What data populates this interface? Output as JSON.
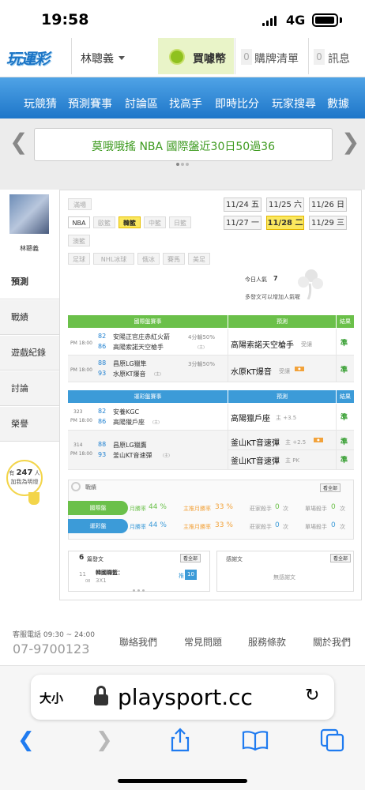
{
  "status": {
    "time": "19:58",
    "network": "4G"
  },
  "topbar": {
    "logo": "玩運彩",
    "user": "林聰義",
    "coins_label": "買噱幣",
    "cart_count": "0",
    "cart_label": "購牌清單",
    "msg_count": "0",
    "msg_label": "訊息"
  },
  "nav": [
    "玩競猜",
    "預測賽事",
    "討論區",
    "找高手",
    "即時比分",
    "玩家搜尋",
    "數據"
  ],
  "banner": {
    "text": "莫哦哦搖 NBA 國際盤近30日50過36"
  },
  "profile": {
    "name": "林聰義"
  },
  "sidebar": [
    "預測",
    "戰績",
    "遊戲紀錄",
    "討論",
    "榮譽"
  ],
  "likes": {
    "prefix": "有",
    "count": "247",
    "unit": "人",
    "sub": "加我為明燈"
  },
  "filters": {
    "row1": [
      "滿場"
    ],
    "row2": [
      "NBA",
      "歐籃",
      "韓籃",
      "中籃",
      "日籃"
    ],
    "row3": [
      "澳籃"
    ],
    "row4": [
      "足球",
      "NHL冰球",
      "俄冰",
      "賽馬",
      "美足"
    ]
  },
  "dates": {
    "row1": [
      "11/24 五",
      "11/25 六",
      "11/26 日"
    ],
    "row2": [
      "11/27 一",
      "11/28 二",
      "11/29 三"
    ]
  },
  "popularity": {
    "label": "今日人氣",
    "value": "7",
    "hint": "多發文可以增加人氣喔"
  },
  "intl_table": {
    "headers": [
      "國際盤賽事",
      "預測",
      "結果"
    ],
    "rows": [
      {
        "time": "PM 18:00",
        "num1": "82",
        "team1": "安陽正官庄赤紅火箭",
        "score": "4分輸50%",
        "num2": "86",
        "team2": "高陽索諾天空槍手",
        "mark": "(主)",
        "pick": "高陽索諾天空槍手",
        "pick_sub": "受讓",
        "result": "準"
      },
      {
        "time": "PM 18:00",
        "num1": "88",
        "team1": "昌原LG獵隼",
        "score": "3分輸50%",
        "num2": "93",
        "team2": "水原KT爆音",
        "mark": "(主)",
        "pick": "水原KT爆音",
        "pick_sub": "受讓",
        "result": "準"
      }
    ]
  },
  "lottery_table": {
    "headers": [
      "運彩盤賽事",
      "預測",
      "結果"
    ],
    "rows": [
      {
        "code": "323",
        "time": "PM 18:00",
        "num1": "82",
        "team1": "安養KGC",
        "num2": "86",
        "team2": "高陽獵戶座",
        "mark": "(主)",
        "pick": "高陽獵戶座",
        "pick_sub": "主 +3.5",
        "result": "準"
      },
      {
        "code": "314",
        "time": "PM 18:00",
        "num1": "88",
        "team1": "昌原LG獵鷹",
        "num2": "93",
        "team2": "釜山KT音速彈",
        "mark": "(主)",
        "pick": "釜山KT音速彈",
        "pick_sub": "主 +2.5",
        "result": "準",
        "pick2": "釜山KT音速彈",
        "pick2_sub": "主 PK",
        "result2": "準"
      }
    ]
  },
  "record": {
    "title": "戰績",
    "view_all": "看全部",
    "rows": [
      {
        "label": "國際盤",
        "monthly_label": "月勝率",
        "monthly": "44 %",
        "home_label": "主推月勝率",
        "home": "33 %",
        "king_label": "莊家殺手",
        "king": "0",
        "king_unit": "次",
        "single_label": "單場殺手",
        "single": "0",
        "single_unit": "次"
      },
      {
        "label": "運彩盤",
        "monthly_label": "月勝率",
        "monthly": "44 %",
        "home_label": "主推月勝率",
        "home": "33 %",
        "king_label": "莊家殺手",
        "king": "0",
        "king_unit": "次",
        "single_label": "單場殺手",
        "single": "0",
        "single_unit": "次"
      }
    ]
  },
  "posts": {
    "count": "6",
    "title": "篇發文",
    "view_all": "看全部",
    "day": "11",
    "month": "08",
    "topic": "韓國職籃：",
    "subject": "3X1",
    "tag": "推",
    "pushes": "10"
  },
  "thanks": {
    "title": "感謝文",
    "view_all": "看全部",
    "empty": "無感謝文"
  },
  "footer": {
    "phone_label": "客服電話 09:30 ~ 24:00",
    "phone": "07-9700123",
    "links": [
      "聯絡我們",
      "常見問題",
      "服務條款",
      "關於我們"
    ]
  },
  "safari": {
    "aa": "大小",
    "url": "playsport.cc",
    "reload": "↻",
    "back": "❮",
    "forward": "❯"
  },
  "colors": {
    "green_header": "#5cb85c",
    "blue_header": "#3c9bd8",
    "result_green": "#2f9b2a",
    "highlight_yellow": "#fbe85e",
    "nav_blue": "#2a85d6"
  }
}
